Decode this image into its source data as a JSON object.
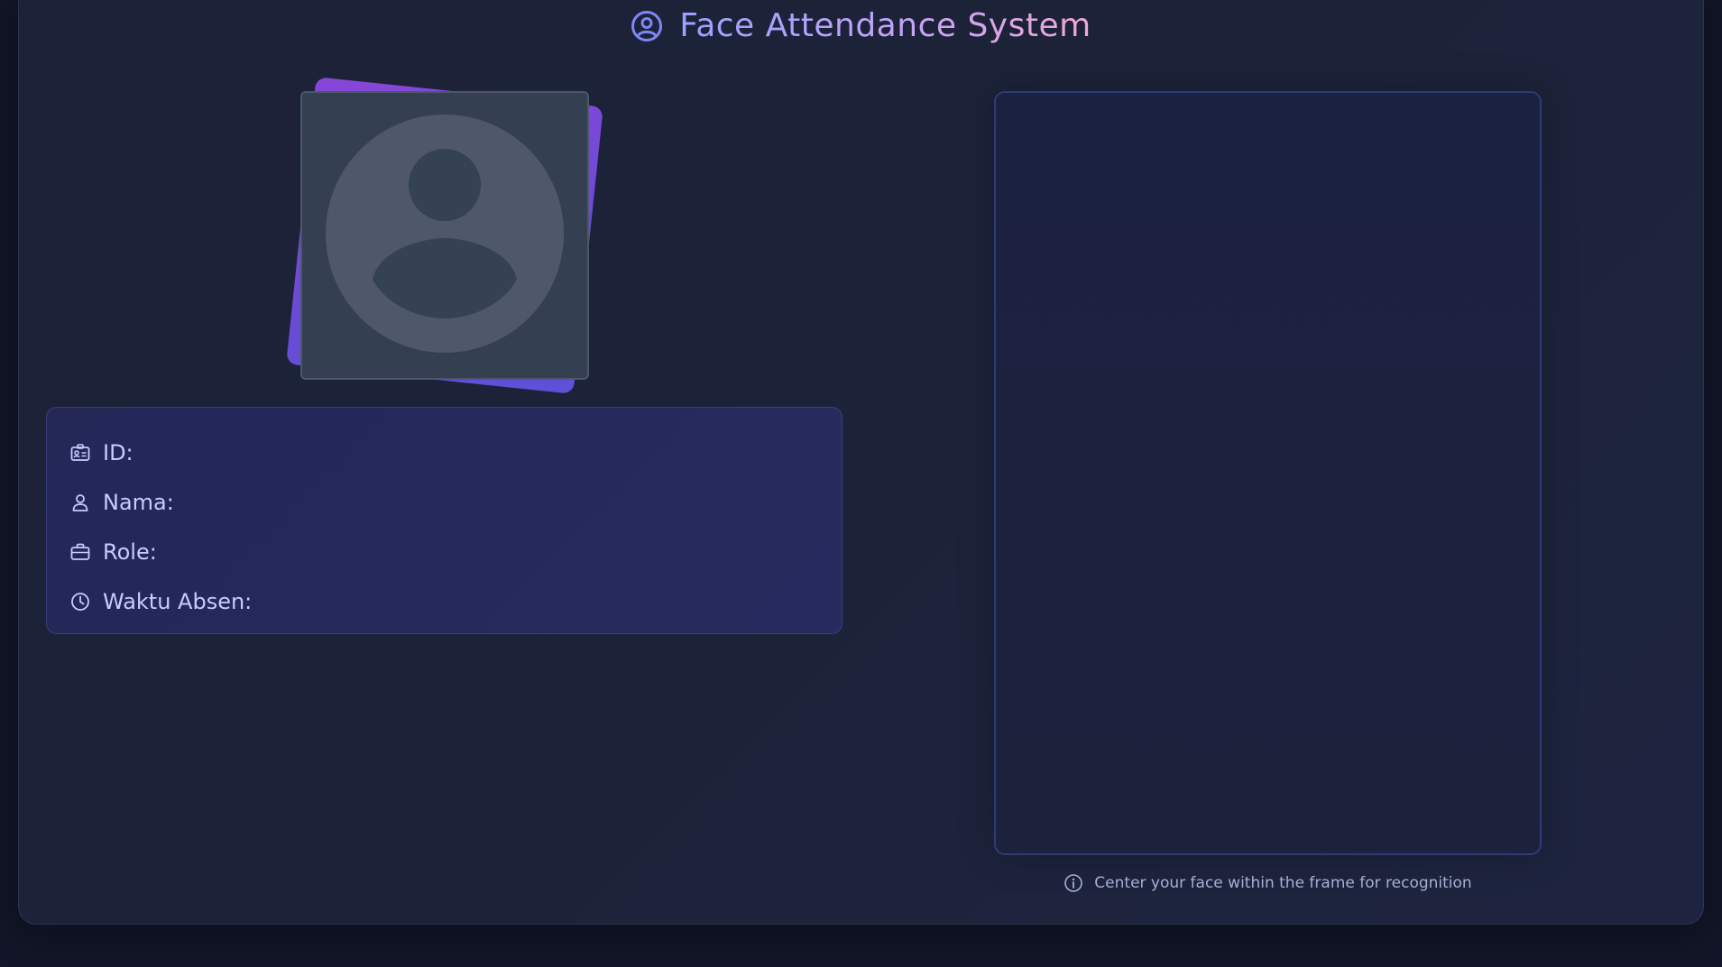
{
  "header": {
    "title": "Face Attendance System",
    "icon": "user-circle-icon"
  },
  "avatar": {
    "icon": "person-placeholder-icon"
  },
  "info": {
    "id_label": "ID:",
    "id_value": "",
    "name_label": "Nama:",
    "name_value": "",
    "role_label": "Role:",
    "role_value": "",
    "time_label": "Waktu Absen:",
    "time_value": ""
  },
  "camera": {
    "hint": "Center your face within the frame for recognition"
  },
  "colors": {
    "accent": "#7c85ff",
    "title_gradient_start": "#9aa2ff",
    "title_gradient_end": "#f1a7d5",
    "background": "#1d2238"
  }
}
